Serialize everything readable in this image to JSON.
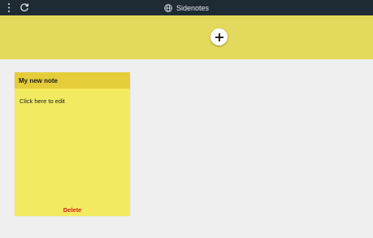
{
  "window": {
    "title": "Sidenotes",
    "menu_icon": "kebab-menu-icon",
    "refresh_icon": "refresh-icon",
    "globe_icon": "globe-icon"
  },
  "toolbar": {
    "add_icon": "plus-icon"
  },
  "notes": [
    {
      "title": "My new note",
      "body": "Click here to edit",
      "delete_label": "Delete"
    }
  ],
  "colors": {
    "titlebar": "#1f2b33",
    "banner": "#e3d95c",
    "note_header": "#e5cd3a",
    "note_body": "#f2ea61",
    "delete": "#e01d1d",
    "background": "#efefef"
  }
}
